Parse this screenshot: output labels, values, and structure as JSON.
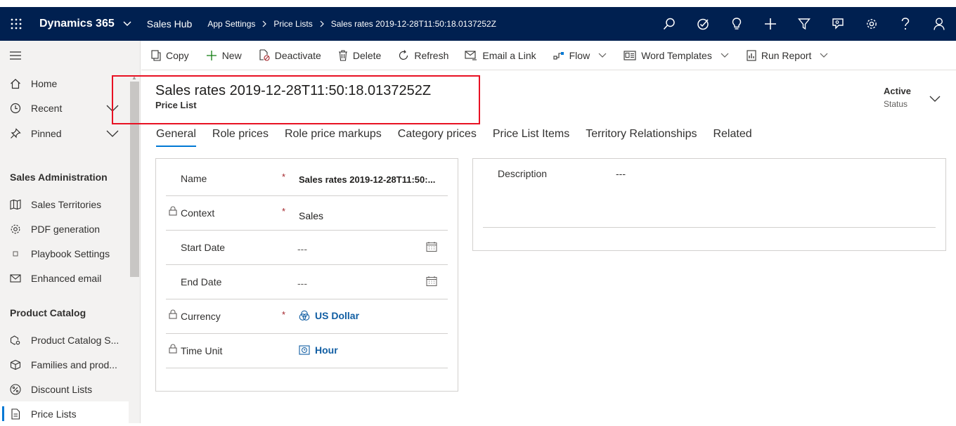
{
  "topbar": {
    "app_name": "Dynamics 365",
    "hub_name": "Sales Hub",
    "breadcrumb": [
      "App Settings",
      "Price Lists",
      "Sales rates 2019-12-28T11:50:18.0137252Z"
    ]
  },
  "sidebar": {
    "items_top": [
      {
        "label": "Home",
        "icon": "home-icon"
      },
      {
        "label": "Recent",
        "icon": "clock-icon"
      },
      {
        "label": "Pinned",
        "icon": "pin-icon"
      }
    ],
    "section_admin": "Sales Administration",
    "admin_items": [
      {
        "label": "Sales Territories",
        "icon": "map-icon"
      },
      {
        "label": "PDF generation",
        "icon": "gear-icon"
      },
      {
        "label": "Playbook Settings",
        "icon": "square-icon"
      },
      {
        "label": "Enhanced email",
        "icon": "mail-icon"
      }
    ],
    "section_catalog": "Product Catalog",
    "catalog_items": [
      {
        "label": "Product Catalog S...",
        "icon": "catalog-gear-icon"
      },
      {
        "label": "Families and prod...",
        "icon": "box-icon"
      },
      {
        "label": "Discount Lists",
        "icon": "percent-icon"
      },
      {
        "label": "Price Lists",
        "icon": "document-icon"
      }
    ]
  },
  "commands": {
    "copy": "Copy",
    "new": "New",
    "deactivate": "Deactivate",
    "delete": "Delete",
    "refresh": "Refresh",
    "email_link": "Email a Link",
    "flow": "Flow",
    "word_templates": "Word Templates",
    "run_report": "Run Report"
  },
  "record": {
    "title": "Sales rates 2019-12-28T11:50:18.0137252Z",
    "entity": "Price List",
    "status_value": "Active",
    "status_label": "Status"
  },
  "tabs": [
    "General",
    "Role prices",
    "Role price markups",
    "Category prices",
    "Price List Items",
    "Territory Relationships",
    "Related"
  ],
  "form": {
    "required_mark": "*",
    "name_label": "Name",
    "name_value": "Sales rates   2019-12-28T11:50:...",
    "context_label": "Context",
    "context_value": "Sales",
    "start_label": "Start Date",
    "start_value": "---",
    "end_label": "End Date",
    "end_value": "---",
    "currency_label": "Currency",
    "currency_value": "US Dollar",
    "timeunit_label": "Time Unit",
    "timeunit_value": "Hour",
    "description_label": "Description",
    "description_value": "---"
  },
  "colors": {
    "topbar": "#002050",
    "accent": "#0078d4",
    "link": "#115ea3",
    "highlight_box": "#e81123"
  }
}
